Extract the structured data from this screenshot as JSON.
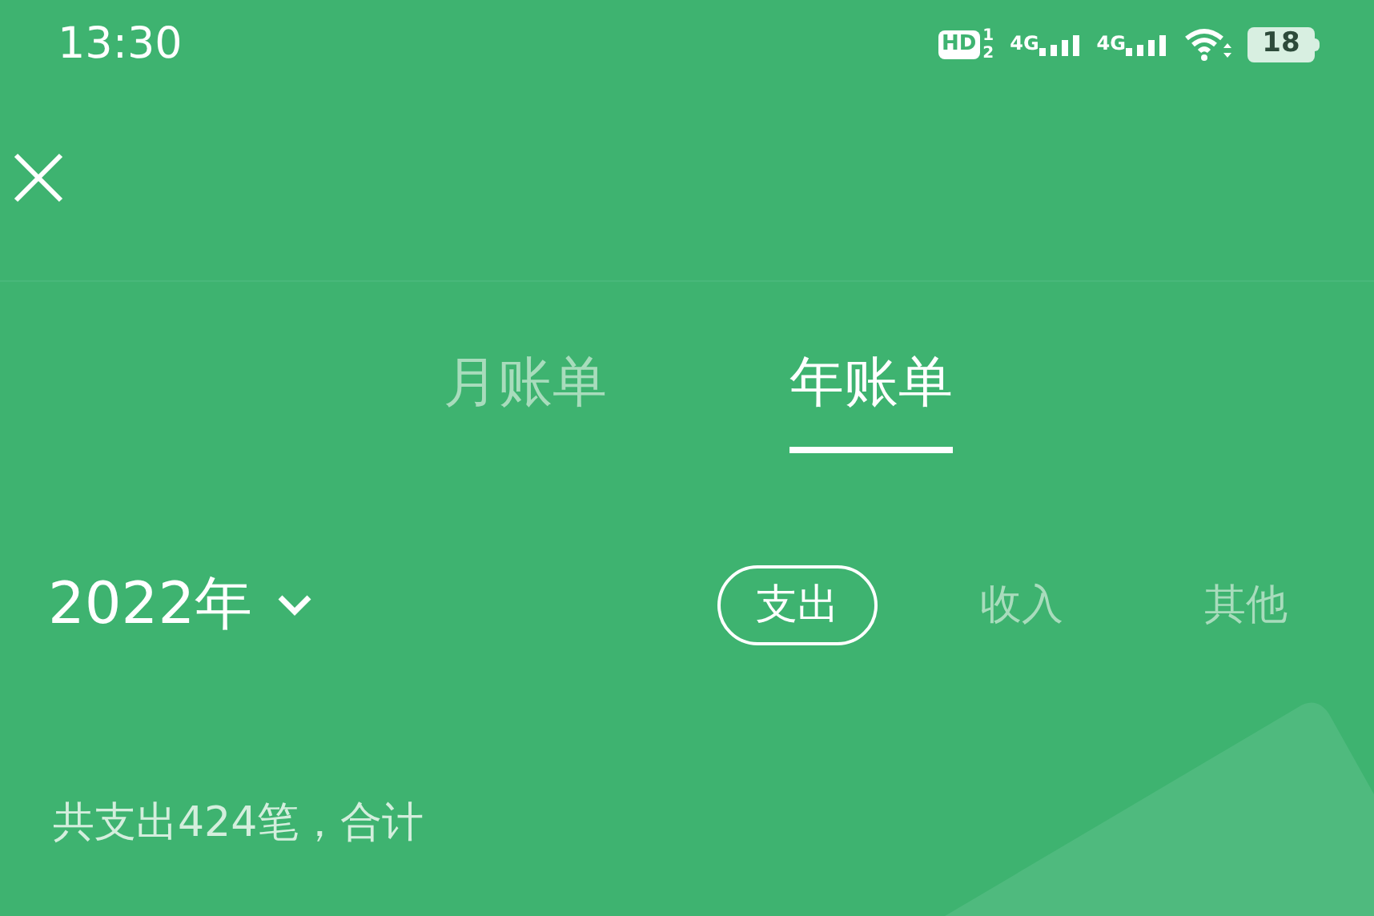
{
  "status_bar": {
    "time": "13:30",
    "hd_badge": "HD",
    "sim_slots": [
      "1",
      "2"
    ],
    "networks": [
      {
        "label": "4G"
      },
      {
        "label": "4G"
      }
    ],
    "battery": "18"
  },
  "tabs": [
    {
      "label": "月账单",
      "selected": false
    },
    {
      "label": "年账单",
      "selected": true
    }
  ],
  "year_picker": {
    "label": "2022年"
  },
  "filters": [
    {
      "label": "支出",
      "selected": true
    },
    {
      "label": "收入",
      "selected": false
    },
    {
      "label": "其他",
      "selected": false
    }
  ],
  "summary": "共支出424笔，合计"
}
